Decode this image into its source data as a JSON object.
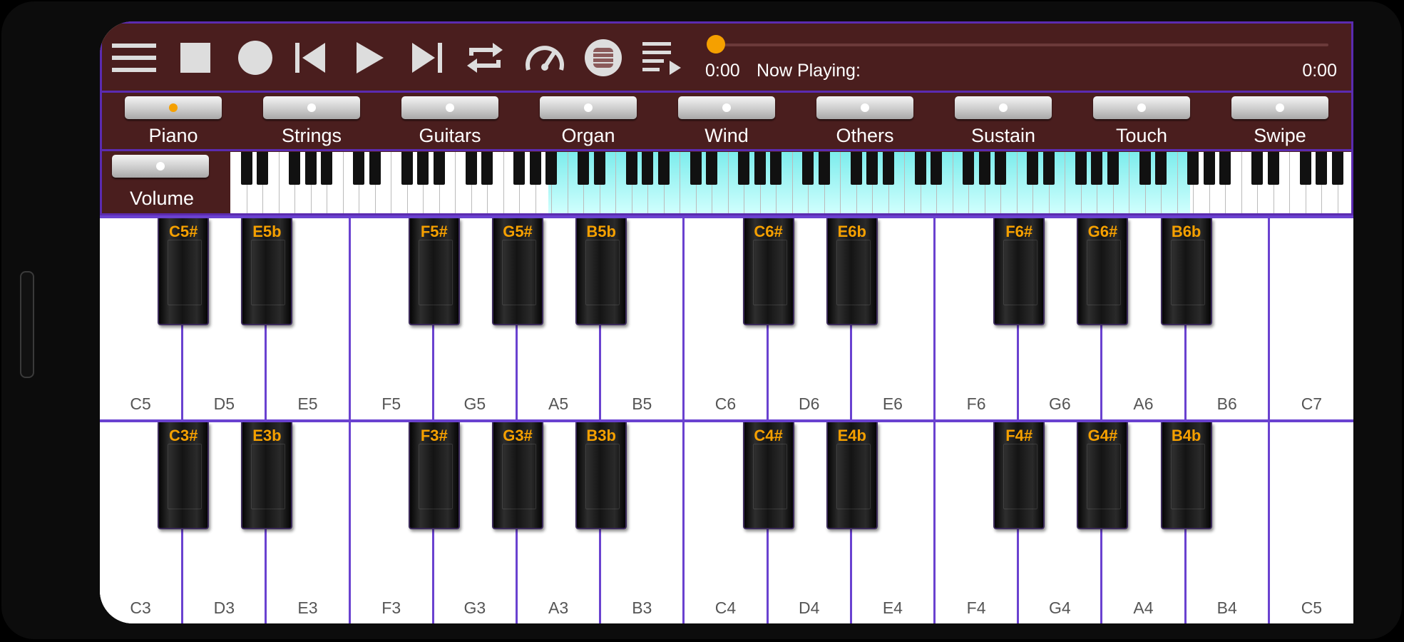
{
  "toolbar": {
    "icons": [
      "menu-icon",
      "stop-icon",
      "record-icon",
      "skip-previous-icon",
      "play-icon",
      "skip-next-icon",
      "repeat-icon",
      "speedometer-icon",
      "drum-icon",
      "playlist-icon"
    ],
    "time_elapsed": "0:00",
    "now_playing_label": "Now Playing:",
    "time_total": "0:00",
    "progress": 0
  },
  "options": [
    {
      "label": "Piano",
      "active": true
    },
    {
      "label": "Strings",
      "active": false
    },
    {
      "label": "Guitars",
      "active": false
    },
    {
      "label": "Organ",
      "active": false
    },
    {
      "label": "Wind",
      "active": false
    },
    {
      "label": "Others",
      "active": false
    },
    {
      "label": "Sustain",
      "active": false
    },
    {
      "label": "Touch",
      "active": false
    },
    {
      "label": "Swipe",
      "active": false
    }
  ],
  "volume_label": "Volume",
  "keyboards": [
    {
      "white_keys": [
        "C5",
        "D5",
        "E5",
        "F5",
        "G5",
        "A5",
        "B5",
        "C6",
        "D6",
        "E6",
        "F6",
        "G6",
        "A6",
        "B6",
        "C7"
      ],
      "black_keys": [
        "C5#",
        "E5b",
        "F5#",
        "G5#",
        "B5b",
        "C6#",
        "E6b",
        "F6#",
        "G6#",
        "B6b"
      ]
    },
    {
      "white_keys": [
        "C3",
        "D3",
        "E3",
        "F3",
        "G3",
        "A3",
        "B3",
        "C4",
        "D4",
        "E4",
        "F4",
        "G4",
        "A4",
        "B4",
        "C5"
      ],
      "black_keys": [
        "C3#",
        "E3b",
        "F3#",
        "G3#",
        "B3b",
        "C4#",
        "E4b",
        "F4#",
        "G4#",
        "B4b"
      ]
    }
  ],
  "colors": {
    "panel_bg": "#4a1e1e",
    "accent": "#f5a000",
    "key_border": "#6a42d0"
  }
}
